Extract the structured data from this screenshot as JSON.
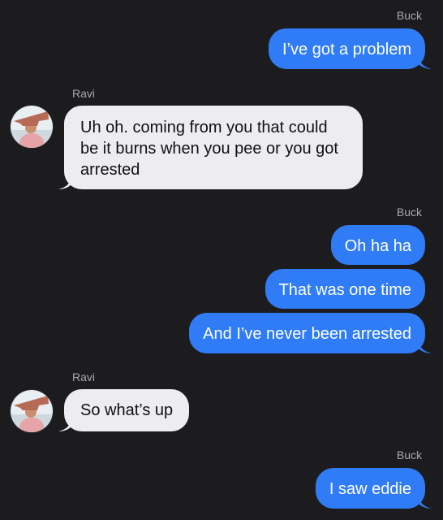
{
  "participants": {
    "self": "Buck",
    "other": "Ravi"
  },
  "messages": [
    {
      "sender": "Buck",
      "text": "I’ve got a problem"
    },
    {
      "sender": "Ravi",
      "text": "Uh oh. coming from you that could be it burns when you pee or you got arrested"
    },
    {
      "sender": "Buck",
      "text": "Oh ha ha"
    },
    {
      "sender": "Buck",
      "text": "That was one time"
    },
    {
      "sender": "Buck",
      "text": "And I’ve never been arrested"
    },
    {
      "sender": "Ravi",
      "text": "So what’s up"
    },
    {
      "sender": "Buck",
      "text": "I saw eddie"
    }
  ],
  "colors": {
    "background": "#1c1c1e",
    "outgoing_bubble": "#2f7cf6",
    "incoming_bubble": "#ececf1",
    "label": "#a8a8ad"
  },
  "icons": {
    "avatar": "ravi-avatar-photo"
  }
}
